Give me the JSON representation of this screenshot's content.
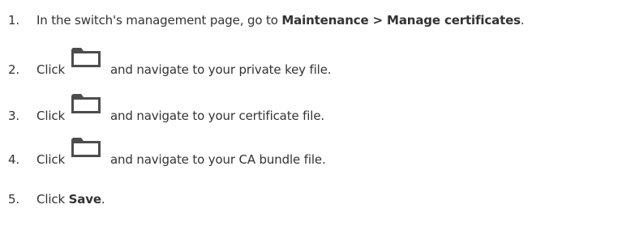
{
  "steps": [
    {
      "number": "1.",
      "prefix": "In the switch's management page, go to ",
      "bold": "Maintenance > Manage certificates",
      "suffix": "."
    },
    {
      "number": "2.",
      "prefix": "Click",
      "icon": "folder-icon",
      "suffix": "and navigate to your private key file."
    },
    {
      "number": "3.",
      "prefix": "Click",
      "icon": "folder-icon",
      "suffix": "and navigate to your certificate file."
    },
    {
      "number": "4.",
      "prefix": "Click",
      "icon": "folder-icon",
      "suffix": "and navigate to your CA bundle file."
    },
    {
      "number": "5.",
      "prefix": "Click ",
      "bold": "Save",
      "suffix": "."
    }
  ],
  "colors": {
    "text": "#333333",
    "icon": "#4d4d4d"
  }
}
